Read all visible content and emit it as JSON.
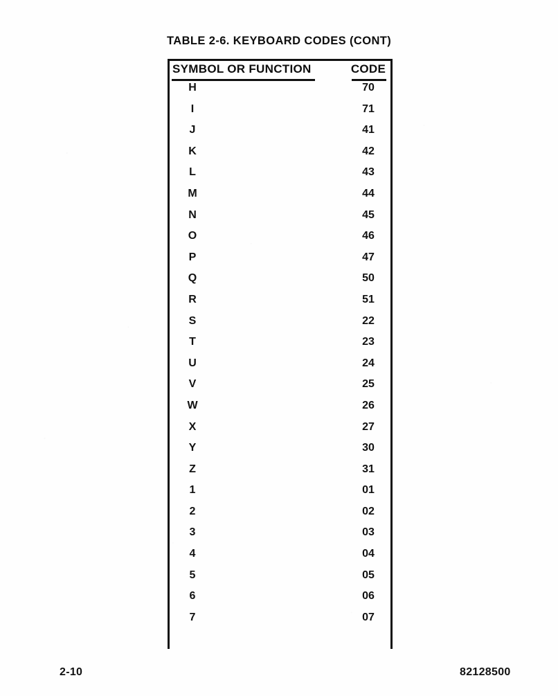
{
  "page": {
    "caption": "TABLE 2-6.  KEYBOARD CODES (CONT)",
    "page_number": "2-10",
    "document_number": "82128500"
  },
  "table": {
    "columns": {
      "symbol": "SYMBOL OR FUNCTION",
      "code": "CODE"
    },
    "rows": [
      {
        "symbol": "H",
        "code": "70"
      },
      {
        "symbol": "I",
        "code": "71"
      },
      {
        "symbol": "J",
        "code": "41"
      },
      {
        "symbol": "K",
        "code": "42"
      },
      {
        "symbol": "L",
        "code": "43"
      },
      {
        "symbol": "M",
        "code": "44"
      },
      {
        "symbol": "N",
        "code": "45"
      },
      {
        "symbol": "O",
        "code": "46"
      },
      {
        "symbol": "P",
        "code": "47"
      },
      {
        "symbol": "Q",
        "code": "50"
      },
      {
        "symbol": "R",
        "code": "51"
      },
      {
        "symbol": "S",
        "code": "22"
      },
      {
        "symbol": "T",
        "code": "23"
      },
      {
        "symbol": "U",
        "code": "24"
      },
      {
        "symbol": "V",
        "code": "25"
      },
      {
        "symbol": "W",
        "code": "26"
      },
      {
        "symbol": "X",
        "code": "27"
      },
      {
        "symbol": "Y",
        "code": "30"
      },
      {
        "symbol": "Z",
        "code": "31"
      },
      {
        "symbol": "1",
        "code": "01"
      },
      {
        "symbol": "2",
        "code": "02"
      },
      {
        "symbol": "3",
        "code": "03"
      },
      {
        "symbol": "4",
        "code": "04"
      },
      {
        "symbol": "5",
        "code": "05"
      },
      {
        "symbol": "6",
        "code": "06"
      },
      {
        "symbol": "7",
        "code": "07"
      }
    ]
  }
}
